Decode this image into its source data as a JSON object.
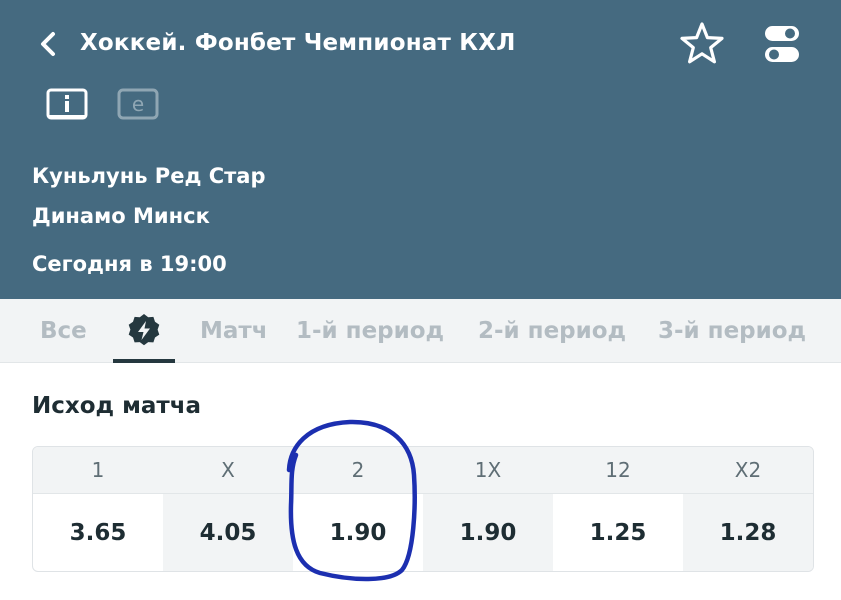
{
  "header": {
    "title": "Хоккей. Фонбет Чемпионат КХЛ",
    "icons": [
      "chevron-left-icon",
      "star-icon",
      "toggle-icon",
      "info-icon",
      "e-icon"
    ],
    "bg_color": "#456a80"
  },
  "match": {
    "team1": "Куньлунь Ред Стар",
    "team2": "Динамо Минск",
    "time": "Сегодня в 19:00"
  },
  "tabs": [
    {
      "label": "Все"
    },
    {
      "label": "",
      "icon": "lightning-badge-icon",
      "active": true
    },
    {
      "label": "Матч"
    },
    {
      "label": "1-й период"
    },
    {
      "label": "2-й период"
    },
    {
      "label": "3-й период"
    }
  ],
  "market": {
    "title": "Исход матча",
    "headers": [
      "1",
      "X",
      "2",
      "1X",
      "12",
      "X2"
    ],
    "values": [
      "3.65",
      "4.05",
      "1.90",
      "1.90",
      "1.25",
      "1.28"
    ]
  },
  "annotation": {
    "circled_outcome": "2",
    "color": "#1c2fb0"
  }
}
